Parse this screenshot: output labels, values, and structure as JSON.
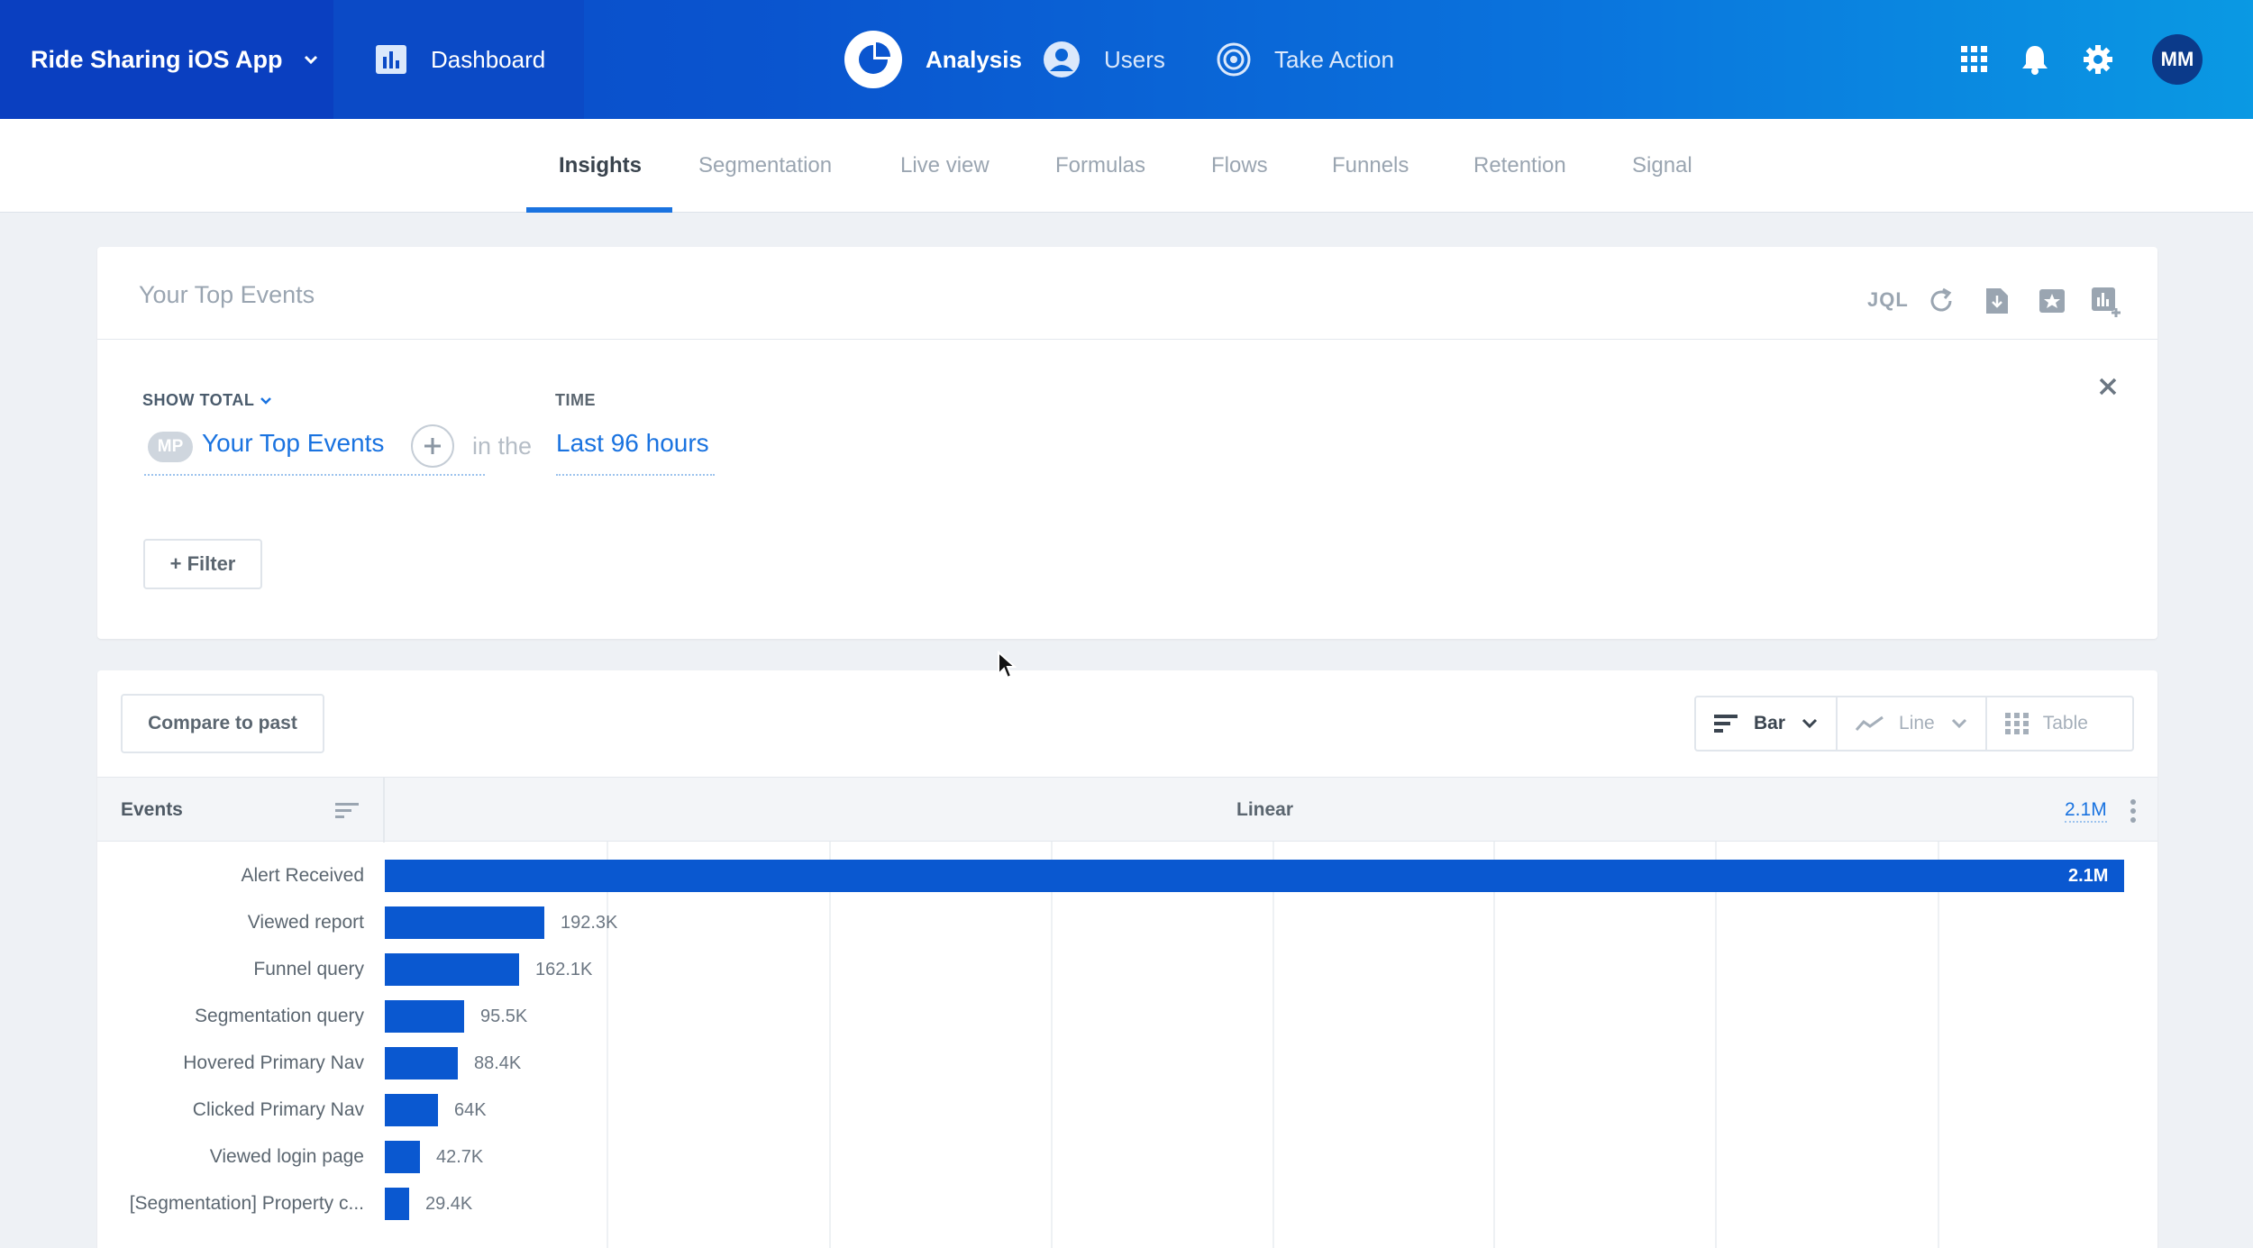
{
  "header": {
    "project": "Ride Sharing iOS App",
    "dashboard": "Dashboard",
    "nav": [
      "Analysis",
      "Users",
      "Take Action"
    ],
    "avatar": "MM",
    "brand_color": "#0a55cf"
  },
  "subnav": {
    "tabs": [
      "Insights",
      "Segmentation",
      "Live view",
      "Formulas",
      "Flows",
      "Funnels",
      "Retention",
      "Signal"
    ],
    "active": "Insights"
  },
  "query": {
    "title": "Your Top Events",
    "toolbar": {
      "jql": "JQL"
    },
    "show_label": "SHOW TOTAL",
    "time_label": "TIME",
    "badge": "MP",
    "event": "Your Top Events",
    "connector": "in the",
    "time_value": "Last 96 hours",
    "filter": "+ Filter"
  },
  "results": {
    "compare": "Compare to past",
    "views": [
      "Bar",
      "Line",
      "Table"
    ],
    "selected_view": "Bar",
    "col_events": "Events",
    "scale": "Linear",
    "max": "2.1M"
  },
  "chart_data": {
    "type": "bar",
    "orientation": "horizontal",
    "categories": [
      "Alert Received",
      "Viewed report",
      "Funnel query",
      "Segmentation query",
      "Hovered Primary Nav",
      "Clicked Primary Nav",
      "Viewed login page",
      "[Segmentation] Property c..."
    ],
    "values": [
      2100000,
      192300,
      162100,
      95500,
      88400,
      64000,
      42700,
      29400
    ],
    "labels": [
      "2.1M",
      "192.3K",
      "162.1K",
      "95.5K",
      "88.4K",
      "64K",
      "42.7K",
      "29.4K"
    ],
    "xlim": [
      0,
      2100000
    ],
    "grid": true,
    "color": "#0a58d0"
  }
}
